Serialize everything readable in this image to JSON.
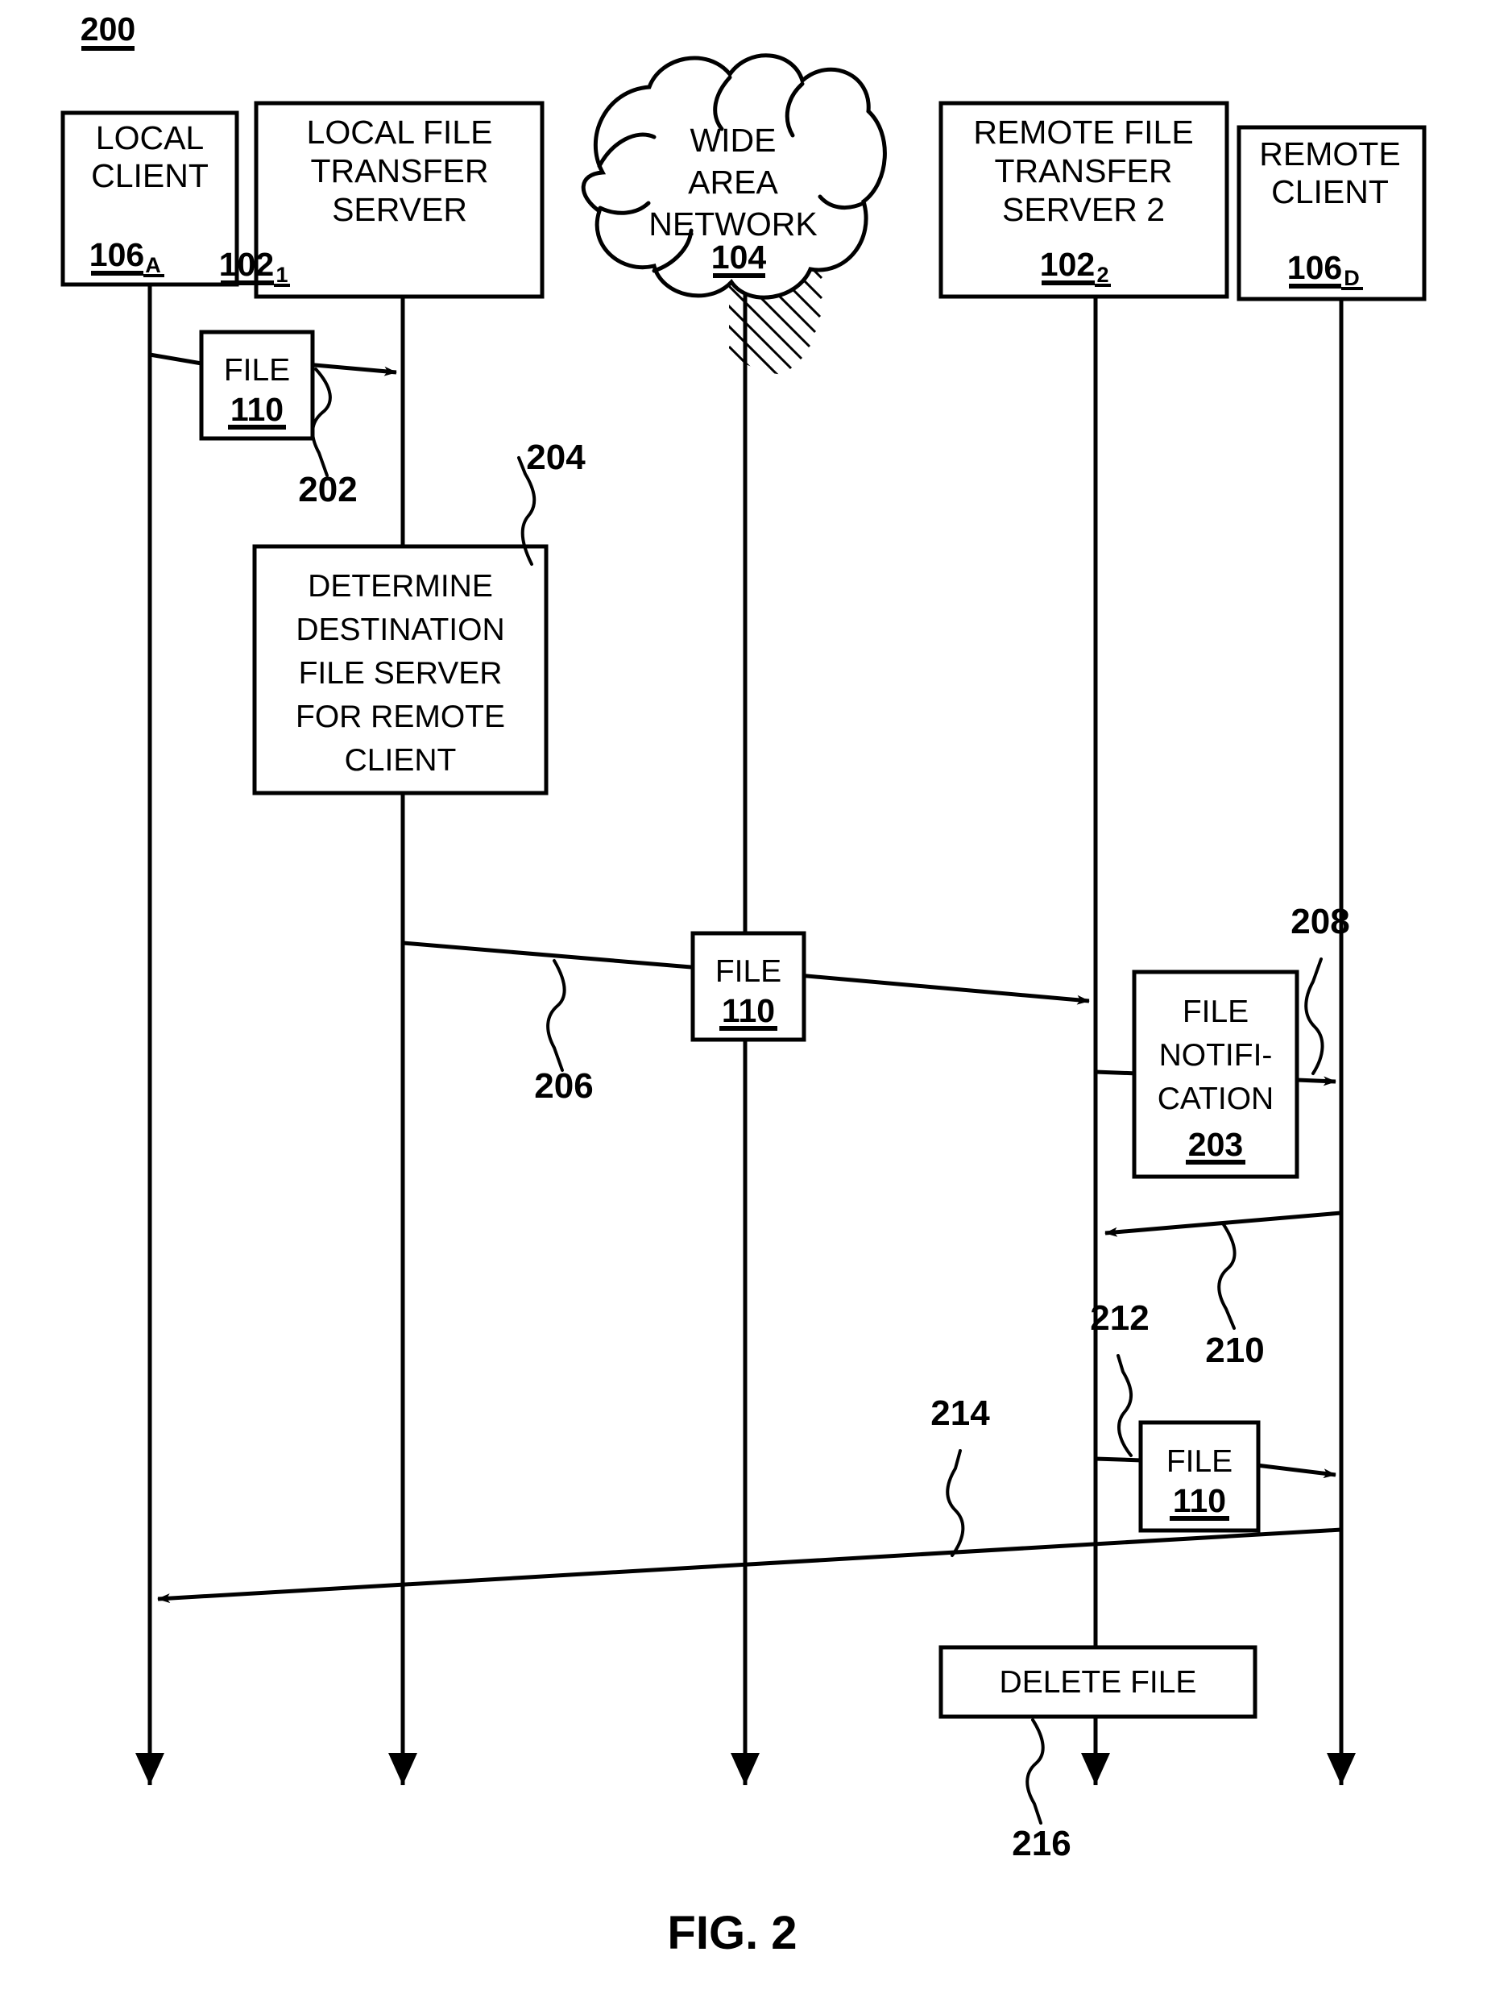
{
  "figure": {
    "caption": "FIG. 2",
    "diagram_ref": "200"
  },
  "nodes": [
    {
      "id": "local-client",
      "lines": [
        "LOCAL",
        "CLIENT"
      ],
      "ref": "106",
      "ref_sub": "A"
    },
    {
      "id": "local-file-transfer-server",
      "lines": [
        "LOCAL FILE",
        "TRANSFER",
        "SERVER"
      ],
      "ref": "102",
      "ref_sub": "1"
    },
    {
      "id": "wide-area-network",
      "lines": [
        "WIDE",
        "AREA",
        "NETWORK"
      ],
      "ref": "104",
      "ref_sub": ""
    },
    {
      "id": "remote-file-transfer-server-2",
      "lines": [
        "REMOTE FILE",
        "TRANSFER",
        "SERVER 2"
      ],
      "ref": "102",
      "ref_sub": "2"
    },
    {
      "id": "remote-client",
      "lines": [
        "REMOTE",
        "CLIENT"
      ],
      "ref": "106",
      "ref_sub": "D"
    }
  ],
  "messages": [
    {
      "id": "file-upload",
      "box_lines": [
        "FILE"
      ],
      "box_ref": "110",
      "leader": "202"
    },
    {
      "id": "determine-destination",
      "box_lines": [
        "DETERMINE",
        "DESTINATION",
        "FILE SERVER",
        "FOR REMOTE",
        "CLIENT"
      ],
      "box_ref": "",
      "leader": "204"
    },
    {
      "id": "file-transfer-wan",
      "box_lines": [
        "FILE"
      ],
      "box_ref": "110",
      "leader": "206"
    },
    {
      "id": "file-notification",
      "box_lines": [
        "FILE",
        "NOTIFI-",
        "CATION"
      ],
      "box_ref": "203",
      "leader": "208"
    },
    {
      "id": "download-request",
      "box_lines": [],
      "box_ref": "",
      "leader": "210"
    },
    {
      "id": "file-delivery",
      "box_lines": [
        "FILE"
      ],
      "box_ref": "110",
      "leader": "212"
    },
    {
      "id": "delivery-confirmation",
      "box_lines": [],
      "box_ref": "",
      "leader": "214"
    },
    {
      "id": "delete-file",
      "box_lines": [
        "DELETE FILE"
      ],
      "box_ref": "",
      "leader": "216"
    }
  ],
  "labels": {
    "n200": "200",
    "n202": "202",
    "n204": "204",
    "n206": "206",
    "n208": "208",
    "n210": "210",
    "n212": "212",
    "n214": "214",
    "n216": "216",
    "local_client_l1": "LOCAL",
    "local_client_l2": "CLIENT",
    "local_client_ref": "106",
    "local_client_sub": "A",
    "lfts_l1": "LOCAL FILE",
    "lfts_l2": "TRANSFER",
    "lfts_l3": "SERVER",
    "lfts_ref": "102",
    "lfts_sub": "1",
    "wan_l1": "WIDE",
    "wan_l2": "AREA",
    "wan_l3": "NETWORK",
    "wan_ref": "104",
    "rfts_l1": "REMOTE FILE",
    "rfts_l2": "TRANSFER",
    "rfts_l3": "SERVER 2",
    "rfts_ref": "102",
    "rfts_sub": "2",
    "remote_client_l1": "REMOTE",
    "remote_client_l2": "CLIENT",
    "remote_client_ref": "106",
    "remote_client_sub": "D",
    "file1_l1": "FILE",
    "file1_ref": "110",
    "det_l1": "DETERMINE",
    "det_l2": "DESTINATION",
    "det_l3": "FILE SERVER",
    "det_l4": "FOR REMOTE",
    "det_l5": "CLIENT",
    "file2_l1": "FILE",
    "file2_ref": "110",
    "notif_l1": "FILE",
    "notif_l2": "NOTIFI-",
    "notif_l3": "CATION",
    "notif_ref": "203",
    "file3_l1": "FILE",
    "file3_ref": "110",
    "delete_l1": "DELETE FILE",
    "fig_caption": "FIG. 2"
  },
  "colors": {
    "ink": "#000000",
    "paper": "#ffffff"
  }
}
